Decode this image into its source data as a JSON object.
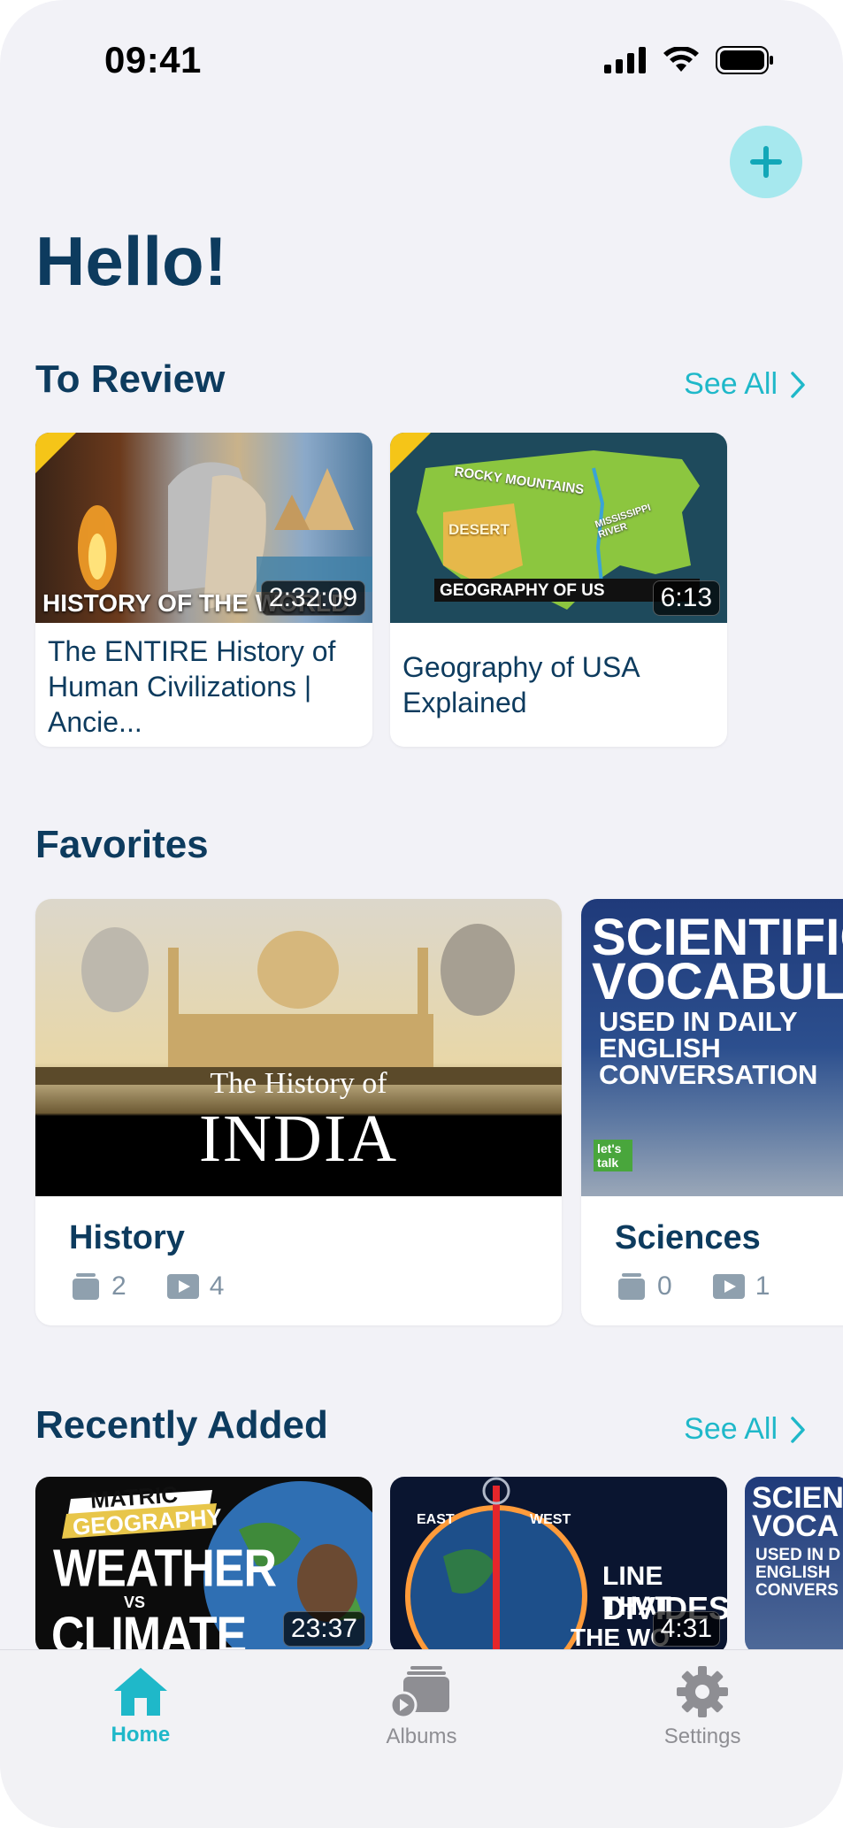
{
  "status_bar": {
    "time": "09:41"
  },
  "header": {
    "greeting": "Hello!",
    "add_icon": "plus-icon"
  },
  "to_review": {
    "title": "To Review",
    "see_all_label": "See All",
    "videos": [
      {
        "thumbnail_text": "HISTORY OF THE WORLD",
        "duration": "2:32:09",
        "title": "The ENTIRE History of Human Civilizations | Ancie..."
      },
      {
        "thumbnail_text": "GEOGRAPHY OF US",
        "map_labels": [
          "ROCKY MOUNTAINS",
          "DESERT",
          "MISSISSIPPI RIVER"
        ],
        "duration": "6:13",
        "title": "Geography of USA Explained"
      }
    ]
  },
  "favorites": {
    "title": "Favorites",
    "albums": [
      {
        "name": "History",
        "thumb_line1": "The History of",
        "thumb_line2": "INDIA",
        "folders": "2",
        "videos": "4"
      },
      {
        "name": "Sciences",
        "thumb_line1": "SCIENTIFIC",
        "thumb_line2": "VOCABULARY",
        "thumb_line3": "USED IN DAILY ENGLISH CONVERSATION",
        "thumb_badge": "let's talk",
        "folders": "0",
        "videos": "1"
      }
    ]
  },
  "recently_added": {
    "title": "Recently Added",
    "see_all_label": "See All",
    "videos": [
      {
        "thumb_top": "MATRIC",
        "thumb_sub": "GEOGRAPHY",
        "thumb_main1": "WEATHER",
        "thumb_vs": "VS",
        "thumb_main2": "CLIMATE",
        "duration": "23:37"
      },
      {
        "thumb_east": "EAST",
        "thumb_west": "WEST",
        "thumb_main1": "LINE THAT",
        "thumb_main2": "DIVIDES",
        "thumb_main3": "THE WO",
        "duration": "4:31"
      },
      {
        "thumb_line1": "SCIEN",
        "thumb_line2": "VOCA",
        "thumb_line3": "USED IN D",
        "thumb_line4": "ENGLISH",
        "thumb_line5": "CONVERS"
      }
    ]
  },
  "tab_bar": {
    "tabs": [
      {
        "label": "Home",
        "icon": "house-icon",
        "active": true
      },
      {
        "label": "Albums",
        "icon": "albums-icon",
        "active": false
      },
      {
        "label": "Settings",
        "icon": "gear-icon",
        "active": false
      }
    ]
  },
  "colors": {
    "accent": "#1fb8c9",
    "title": "#0d3b5e",
    "background": "#f2f2f7",
    "inactive": "#8e8e93"
  }
}
